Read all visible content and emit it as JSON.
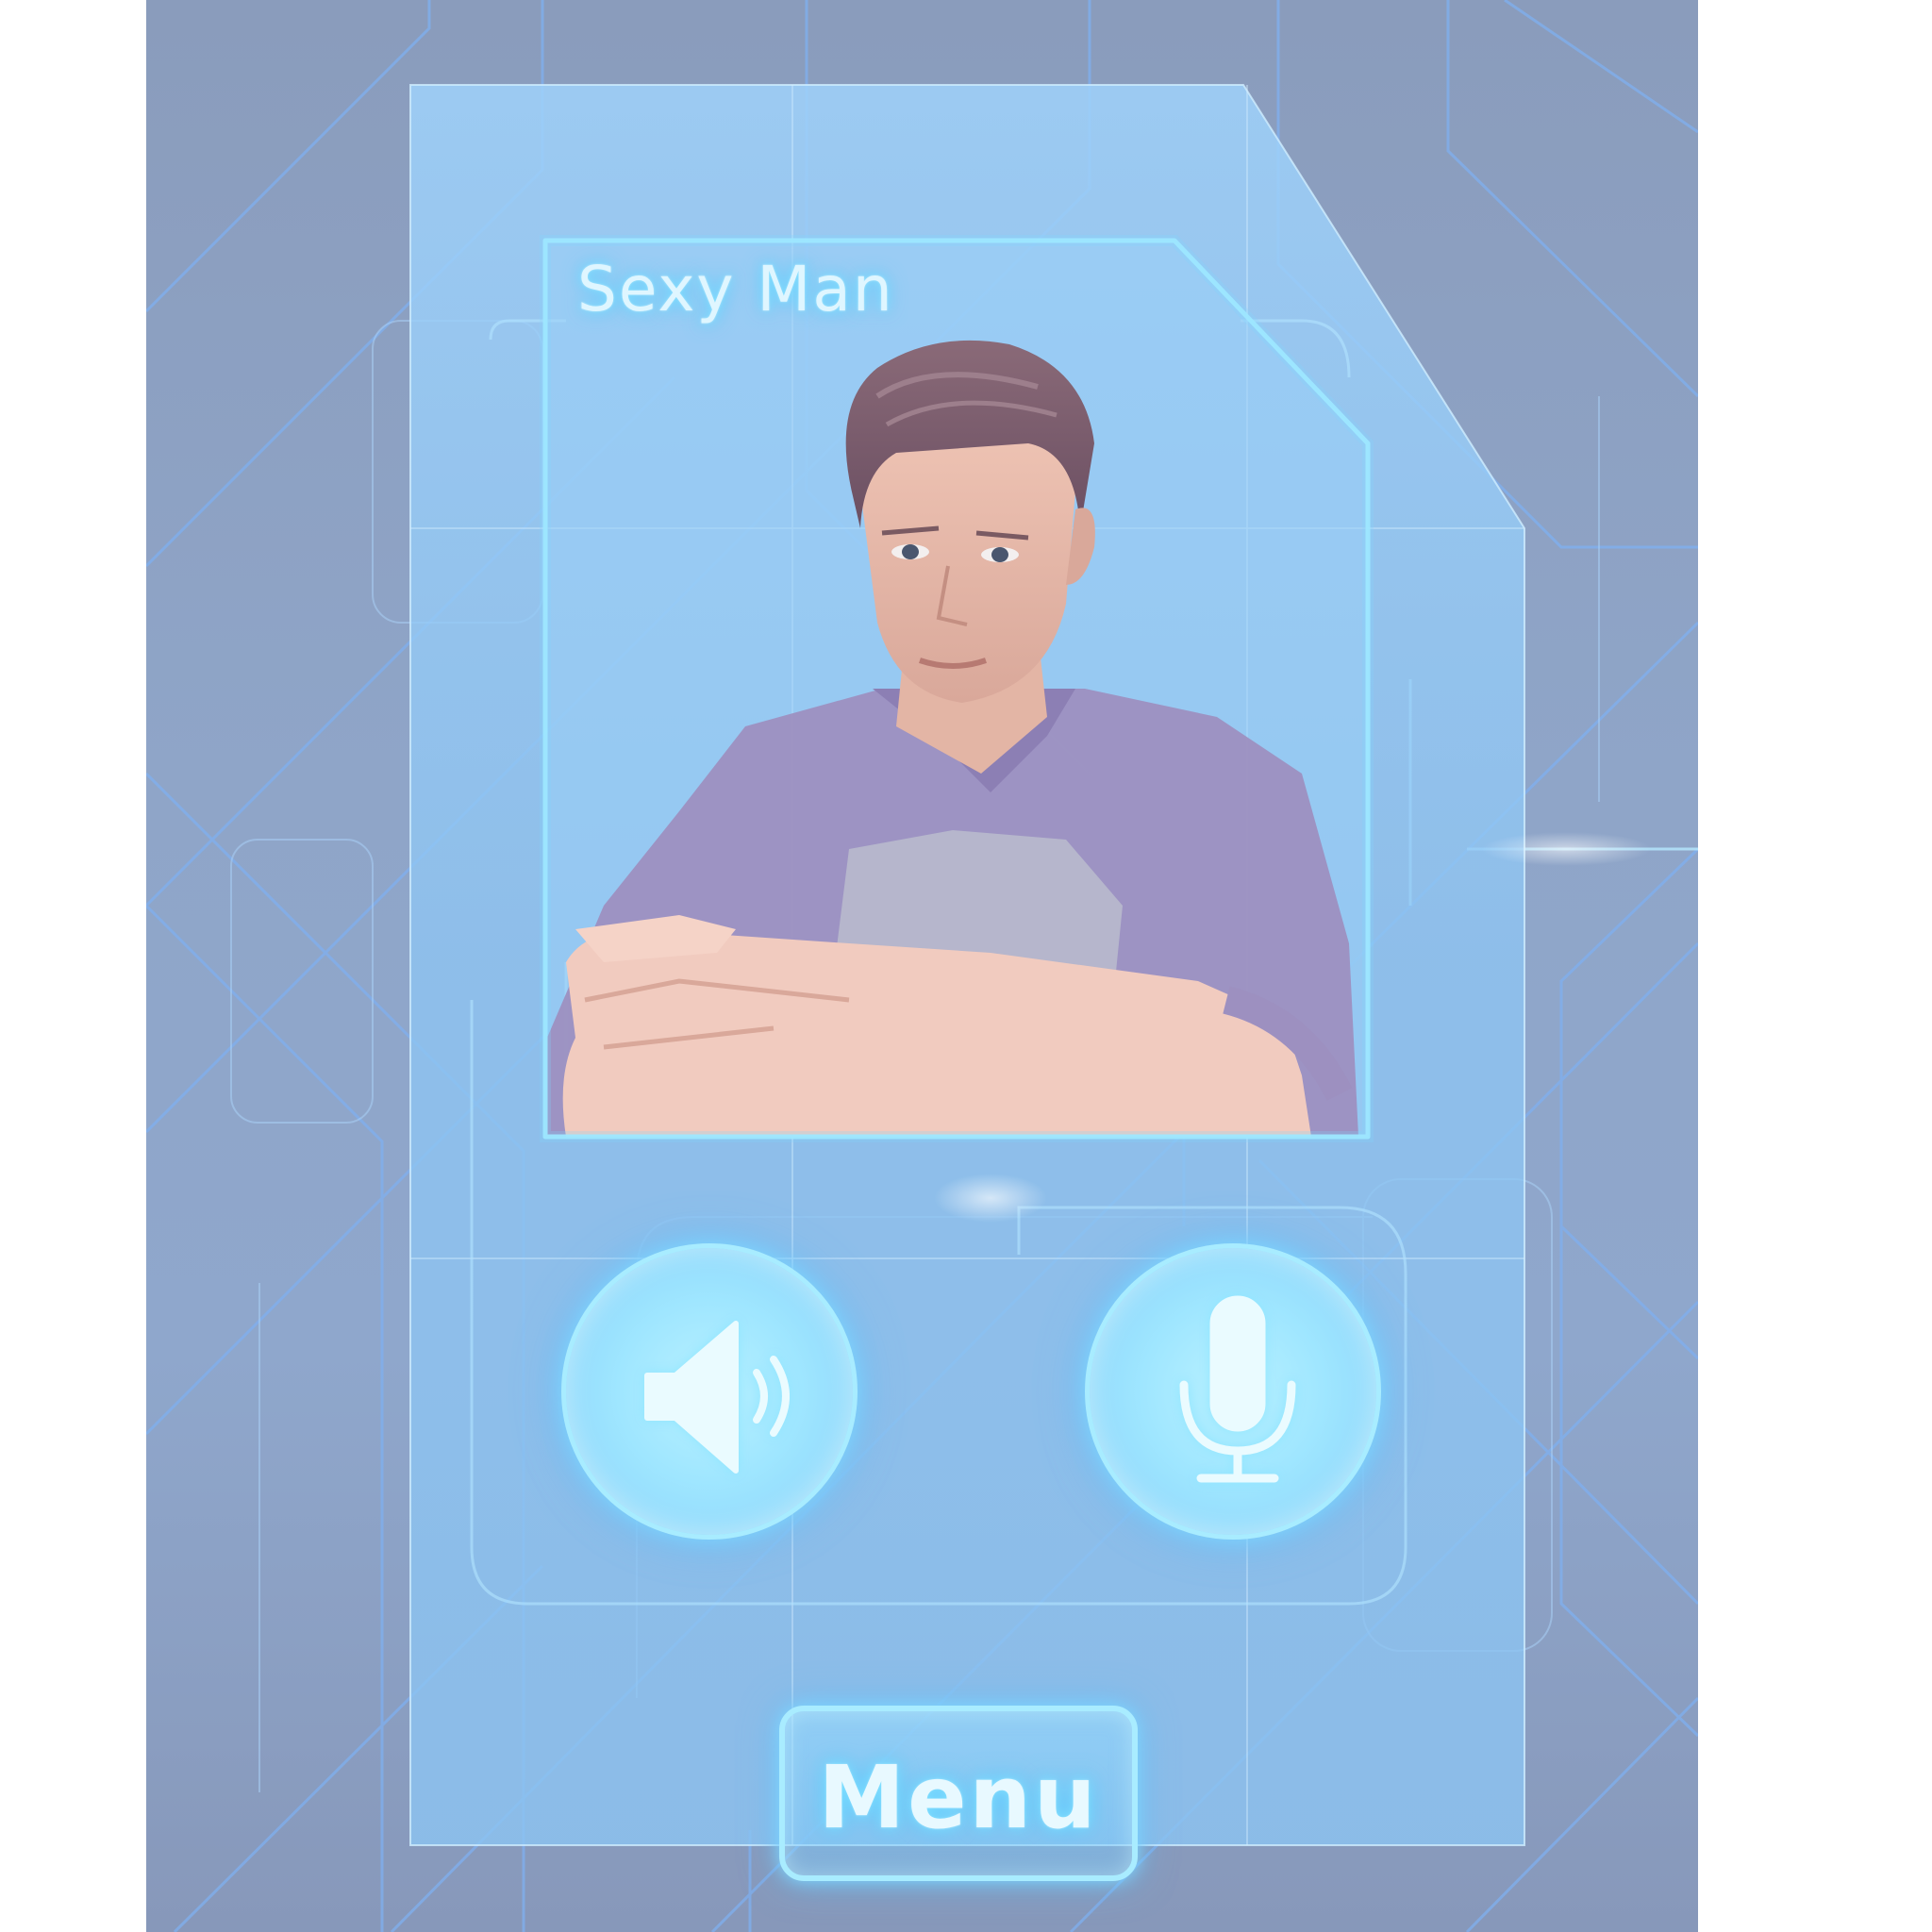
{
  "character": {
    "name": "Sexy Man",
    "portrait": "male-character-portrait"
  },
  "controls": {
    "speaker_icon": "speaker-icon",
    "mic_icon": "microphone-icon",
    "menu_label": "Menu"
  },
  "colors": {
    "background": "#8fa5c8",
    "panel": "#8cc8f5",
    "glow": "#7fd8ff",
    "text": "#dff6ff"
  }
}
